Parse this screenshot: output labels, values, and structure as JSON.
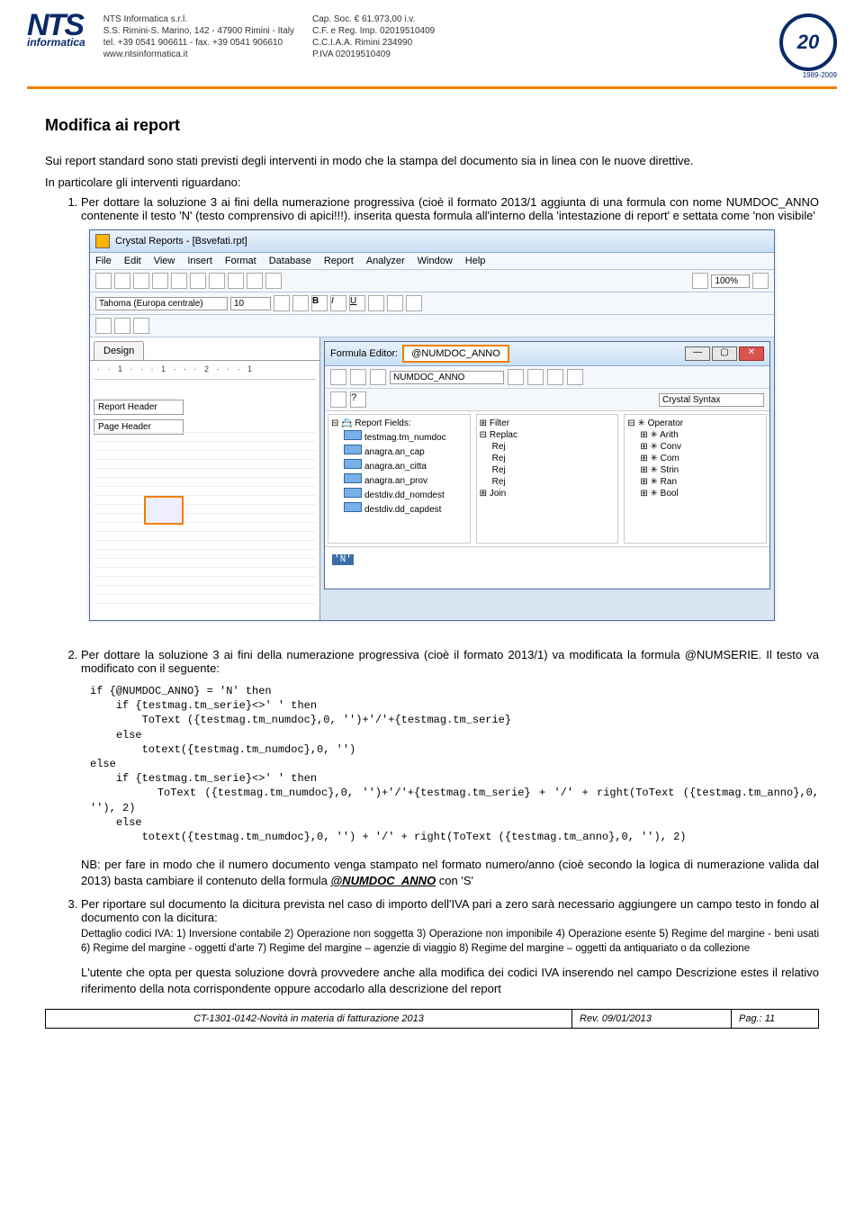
{
  "header": {
    "logo_text": "NTS",
    "logo_sub": "informatica",
    "company_block": "NTS Informatica s.r.l.\nS.S. Rimini-S. Marino, 142 - 47900 Rimini - Italy\ntel. +39 0541 906611 - fax. +39 0541 906610\nwww.ntsinformatica.it",
    "legal_block": "Cap. Soc. € 61.973,00 i.v.\nC.F. e Reg. Imp. 02019510409\nC.C.I.A.A. Rimini 234990\nP.IVA 02019510409",
    "seal_num": "20",
    "seal_years": "1989-2009"
  },
  "body": {
    "title": "Modifica ai report",
    "intro1": "Sui report standard sono stati previsti degli interventi in modo che la stampa del documento sia in linea con le nuove direttive.",
    "intro2": "In particolare gli interventi riguardano:",
    "item1": "Per dottare la soluzione 3 ai fini della numerazione progressiva (cioè il formato 2013/1 aggiunta di una formula con nome NUMDOC_ANNO contenente il testo 'N' (testo comprensivo di apici!!!). inserita questa formula all'interno della 'intestazione di report' e settata come 'non visibile'",
    "item2": "Per dottare la soluzione 3 ai fini della numerazione progressiva (cioè il formato 2013/1) va modificata la formula @NUMSERIE. Il testo va modificato con il seguente:",
    "code": "if {@NUMDOC_ANNO} = 'N' then\n    if {testmag.tm_serie}<>' ' then\n        ToText ({testmag.tm_numdoc},0, '')+'/'+{testmag.tm_serie}\n    else\n        totext({testmag.tm_numdoc},0, '')\nelse\n    if {testmag.tm_serie}<>' ' then\n        ToText ({testmag.tm_numdoc},0, '')+'/'+{testmag.tm_serie} + '/' + right(ToText ({testmag.tm_anno},0, ''), 2)\n    else\n        totext({testmag.tm_numdoc},0, '') + '/' + right(ToText ({testmag.tm_anno},0, ''), 2)",
    "note": "NB: per fare in modo che il numero documento venga stampato nel formato numero/anno (cioè secondo la logica di numerazione valida dal 2013) basta cambiare il contenuto della formula ",
    "note_formula": "@NUMDOC_ANNO",
    "note_tail": " con 'S'",
    "item3a": "Per riportare sul documento la dicitura prevista nel caso di importo dell'IVA pari a zero sarà necessario aggiungere un campo testo in fondo al documento con la dicitura:",
    "item3b": "Dettaglio codici IVA:     1) Inversione contabile     2) Operazione non soggetta     3) Operazione non imponibile     4) Operazione esente    5) Regime del margine - beni usati    6) Regime del margine - oggetti d'arte    7) Regime del margine – agenzie di viaggio    8) Regime del margine – oggetti da antiquariato o da collezione",
    "item3c": "L'utente che opta per questa soluzione dovrà provvedere anche alla modifica dei codici IVA inserendo nel campo Descrizione estes il relativo riferimento della nota corrispondente oppure accodarlo alla descrizione del report"
  },
  "screenshot": {
    "title": "Crystal Reports - [Bsvefati.rpt]",
    "menus": [
      "File",
      "Edit",
      "View",
      "Insert",
      "Format",
      "Database",
      "Report",
      "Analyzer",
      "Window",
      "Help"
    ],
    "font_family": "Tahoma (Europa centrale)",
    "font_size": "10",
    "zoom": "100%",
    "design_tab": "Design",
    "ruler": "· · 1 · · · 1 · · · 2 · · · 1",
    "section_report_header": "Report Header",
    "section_page_header": "Page Header",
    "fe_title": "Formula Editor:",
    "fe_name": "@NUMDOC_ANNO",
    "fe_field": "NUMDOC_ANNO",
    "syntax": "Crystal Syntax",
    "tree_report": {
      "header": "Report Fields:",
      "fields": [
        "testmag.tm_numdoc",
        "anagra.an_cap",
        "anagra.an_citta",
        "anagra.an_prov",
        "destdiv.dd_nomdest",
        "destdiv.dd_capdest"
      ]
    },
    "tree_funcs": {
      "items": [
        "Filter",
        "Replac",
        "Rej",
        "Rej",
        "Rej",
        "Rej",
        "Join"
      ]
    },
    "tree_ops": {
      "header": "Operator",
      "items": [
        "Arith",
        "Conv",
        "Com",
        "Strin",
        "Ran",
        "Bool"
      ]
    },
    "code_line": "'N'"
  },
  "footer": {
    "doc": "CT-1301-0142-Novità in materia di fatturazione 2013",
    "rev": "Rev. 09/01/2013",
    "page": "Pag.: 11"
  }
}
